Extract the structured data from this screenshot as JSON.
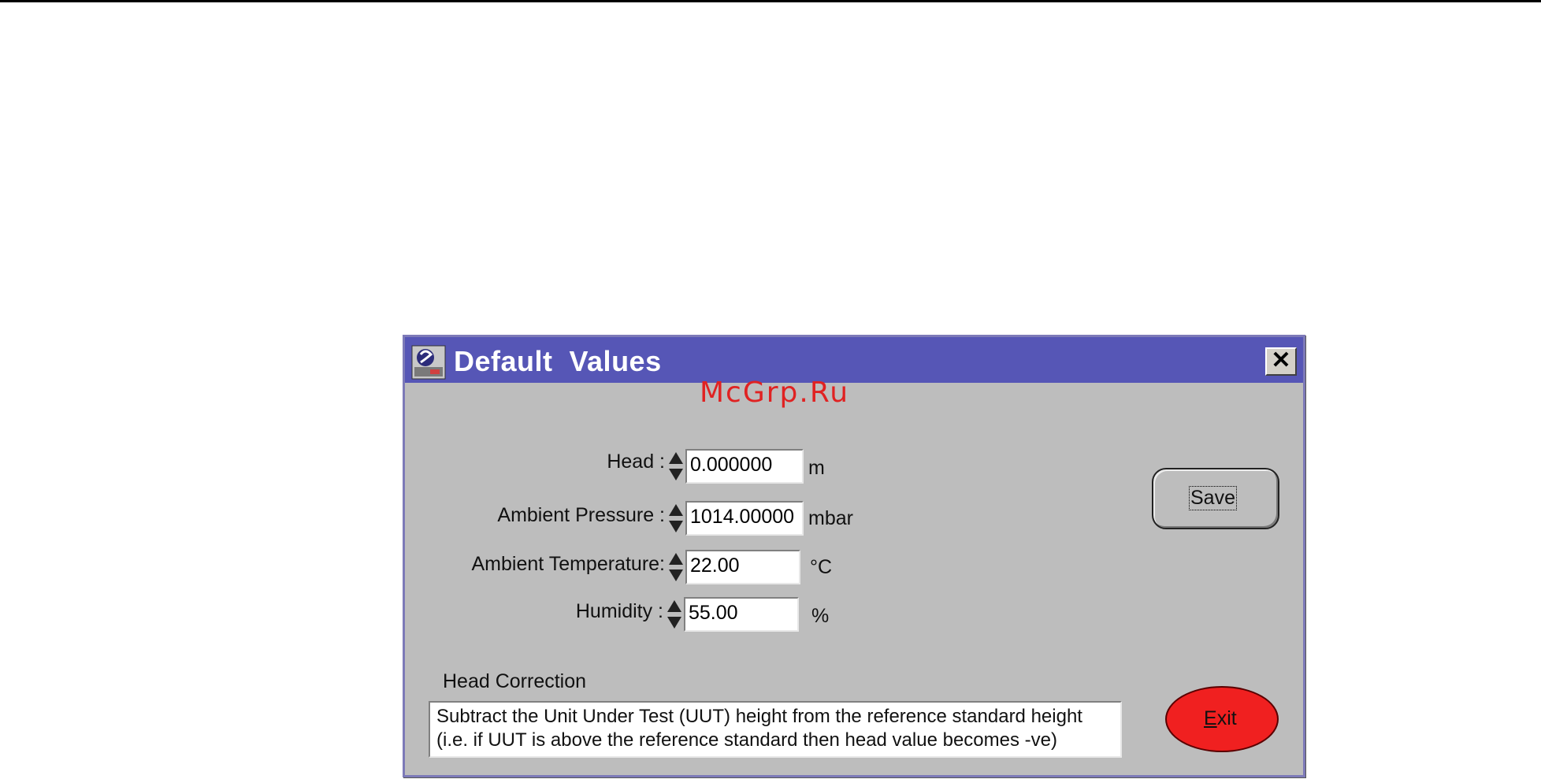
{
  "window": {
    "title": "Default  Values",
    "close_glyph": "✕"
  },
  "watermark": "McGrp.Ru",
  "fields": [
    {
      "label": "Head :",
      "value": "0.000000",
      "unit": "m"
    },
    {
      "label": "Ambient Pressure :",
      "value": "1014.00000",
      "unit": "mbar"
    },
    {
      "label": "Ambient Temperature:",
      "value": "22.00",
      "unit": "°C"
    },
    {
      "label": "Humidity :",
      "value": "55.00",
      "unit": "%"
    }
  ],
  "buttons": {
    "save_label": "Save",
    "exit_label_first": "E",
    "exit_label_rest": "xit"
  },
  "head_correction": {
    "label": "Head Correction",
    "line1": "Subtract the Unit Under Test (UUT) height from the reference standard height",
    "line2": "(i.e. if UUT is above the reference standard  then head value becomes -ve)"
  },
  "colors": {
    "titlebar": "#5656b6",
    "window_bg": "#bdbdbd",
    "exit_button": "#f02020",
    "watermark": "#e02222"
  },
  "icons": [
    "app-icon",
    "close-icon",
    "spinner-icon"
  ]
}
